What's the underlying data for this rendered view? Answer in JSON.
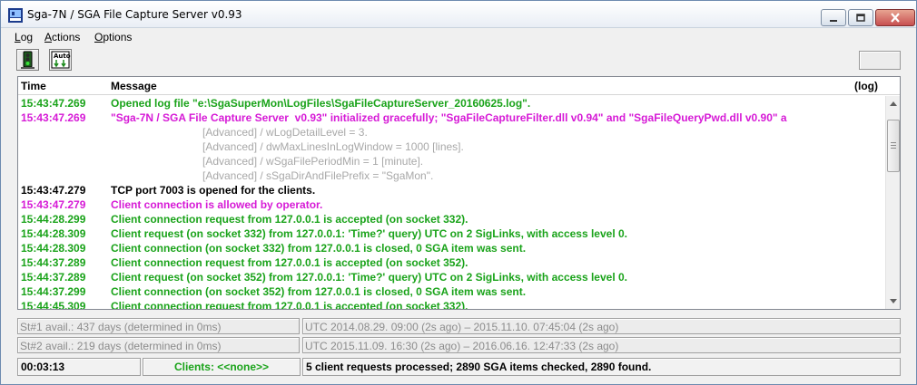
{
  "window": {
    "title": "Sga-7N / SGA File Capture Server  v0.93"
  },
  "menu": [
    {
      "label": "Log",
      "accel": "L"
    },
    {
      "label": "Actions",
      "accel": "A"
    },
    {
      "label": "Options",
      "accel": "O"
    }
  ],
  "toolbar": {
    "buttons": [
      {
        "icon": "traffic-light-icon"
      },
      {
        "icon": "auto-capture-icon",
        "label": "Auto"
      }
    ]
  },
  "log": {
    "columns": {
      "time": "Time",
      "message": "Message",
      "log": "(log)"
    },
    "lines": [
      {
        "time": "15:43:47.269",
        "message": "Opened log file \"e:\\SgaSuperMon\\LogFiles\\SgaFileCaptureServer_20160625.log\".",
        "color": "green"
      },
      {
        "time": "15:43:47.269",
        "message": "\"Sga-7N / SGA File Capture Server  v0.93\" initialized gracefully; \"SgaFileCaptureFilter.dll v0.94\" and \"SgaFileQueryPwd.dll v0.90\" a",
        "color": "magenta"
      },
      {
        "time": "",
        "message": "[Advanced] / wLogDetailLevel = 3.",
        "color": "gray"
      },
      {
        "time": "",
        "message": "[Advanced] / dwMaxLinesInLogWindow = 1000 [lines].",
        "color": "gray"
      },
      {
        "time": "",
        "message": "[Advanced] / wSgaFilePeriodMin = 1 [minute].",
        "color": "gray"
      },
      {
        "time": "",
        "message": "[Advanced] / sSgaDirAndFilePrefix = \"SgaMon\".",
        "color": "gray"
      },
      {
        "time": "15:43:47.279",
        "message": "TCP port 7003 is opened for the clients.",
        "color": "black"
      },
      {
        "time": "15:43:47.279",
        "message": "Client connection is allowed by operator.",
        "color": "magenta"
      },
      {
        "time": "15:44:28.299",
        "message": "Client connection request from 127.0.0.1 is accepted (on socket 332).",
        "color": "green"
      },
      {
        "time": "15:44:28.309",
        "message": "Client request (on socket 332) from 127.0.0.1: 'Time?' query) UTC on 2 SigLinks, with access level 0.",
        "color": "green"
      },
      {
        "time": "15:44:28.309",
        "message": "Client connection (on socket 332) from 127.0.0.1 is closed, 0 SGA item was sent.",
        "color": "green"
      },
      {
        "time": "15:44:37.289",
        "message": "Client connection request from 127.0.0.1 is accepted (on socket 352).",
        "color": "green"
      },
      {
        "time": "15:44:37.289",
        "message": "Client request (on socket 352) from 127.0.0.1: 'Time?' query) UTC on 2 SigLinks, with access level 0.",
        "color": "green"
      },
      {
        "time": "15:44:37.299",
        "message": "Client connection (on socket 352) from 127.0.0.1 is closed, 0 SGA item was sent.",
        "color": "green"
      },
      {
        "time": "15:44:45.309",
        "message": "Client connection request from 127.0.0.1 is accepted (on socket 332).",
        "color": "green"
      }
    ]
  },
  "stations": [
    {
      "avail": "St#1 avail.: 437 days  (determined in 0ms)",
      "range": "UTC 2014.08.29. 09:00 (2s ago)  –  2015.11.10. 07:45:04 (2s ago)"
    },
    {
      "avail": "St#2 avail.: 219 days  (determined in 0ms)",
      "range": "UTC 2015.11.09. 16:30 (2s ago)  –  2016.06.16. 12:47:33 (2s ago)"
    }
  ],
  "statusbar": {
    "uptime": "00:03:13",
    "clients": "Clients: <<none>>",
    "summary": "5 client requests processed;  2890 SGA items checked, 2890 found."
  },
  "colors": {
    "green": "#1aa31a",
    "magenta": "#d61ad6",
    "black": "#000000",
    "gray": "#a8a8a8"
  }
}
